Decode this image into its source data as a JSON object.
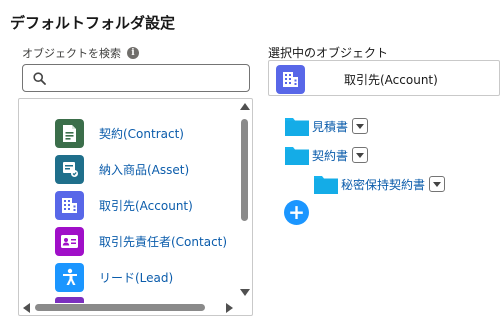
{
  "title": "デフォルトフォルダ設定",
  "search": {
    "label": "オブジェクトを検索",
    "info_icon": "i",
    "value": "",
    "placeholder": ""
  },
  "objects": [
    {
      "label": "契約(Contract)",
      "icon": "contract-icon",
      "color": "#3b6e4a"
    },
    {
      "label": "納入商品(Asset)",
      "icon": "asset-icon",
      "color": "#1f6f8b"
    },
    {
      "label": "取引先(Account)",
      "icon": "account-icon",
      "color": "#5867e8"
    },
    {
      "label": "取引先責任者(Contact)",
      "icon": "contact-icon",
      "color": "#a00fc8"
    },
    {
      "label": "リード(Lead)",
      "icon": "lead-icon",
      "color": "#1b96ff"
    }
  ],
  "selected": {
    "label": "選択中のオブジェクト",
    "name": "取引先(Account)",
    "icon": "account-icon",
    "color": "#5867e8"
  },
  "folders": [
    {
      "name": "見積書",
      "level": 0
    },
    {
      "name": "契約書",
      "level": 0
    },
    {
      "name": "秘密保持契約書",
      "level": 1
    }
  ],
  "colors": {
    "accent": "#1b96ff",
    "folder": "#18b4f0",
    "link": "#0b5cab"
  }
}
